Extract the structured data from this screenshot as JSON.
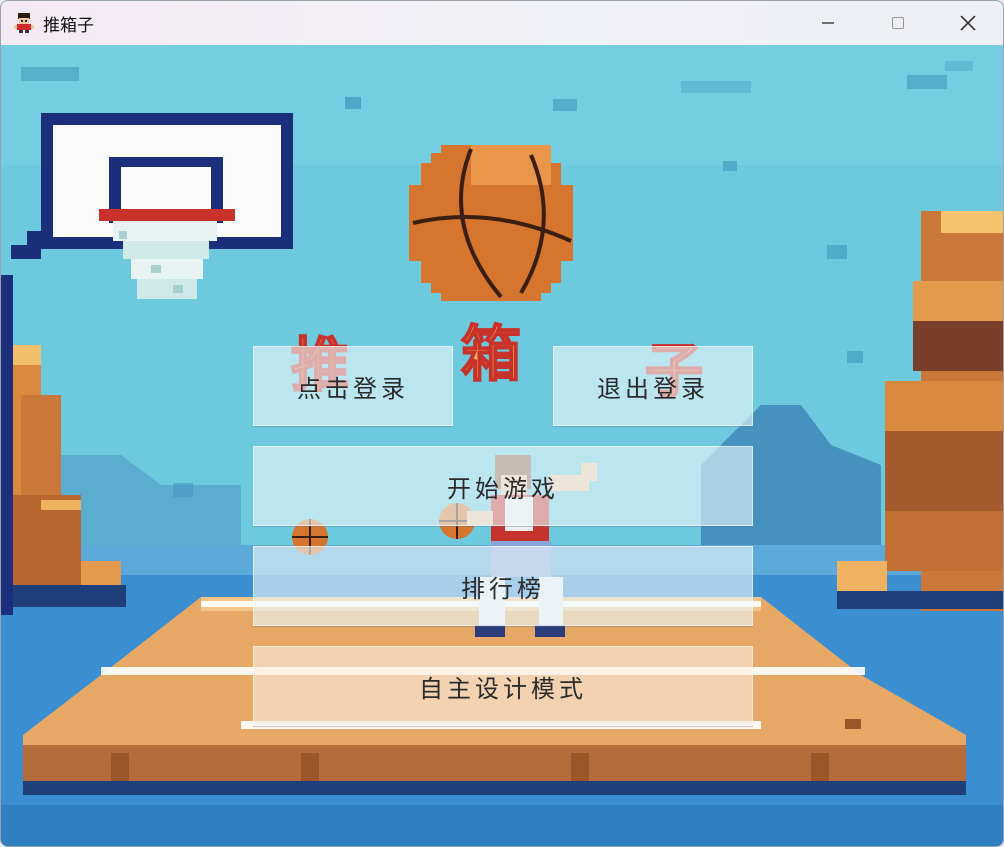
{
  "window": {
    "title": "推箱子"
  },
  "scene": {
    "logo_chars": [
      "推",
      "箱",
      "子"
    ]
  },
  "menu": {
    "login_label": "点击登录",
    "logout_label": "退出登录",
    "start_label": "开始游戏",
    "ranking_label": "排行榜",
    "custom_label": "自主设计模式"
  },
  "colors": {
    "sky": "#6cc9de",
    "court": "#e7a865",
    "water": "#3b8fd0",
    "rim": "#c8322a",
    "ball": "#d6762e"
  },
  "icons": {
    "app": "pixel-character-icon",
    "minimize": "minimize-icon",
    "maximize": "maximize-icon",
    "close": "close-icon"
  }
}
